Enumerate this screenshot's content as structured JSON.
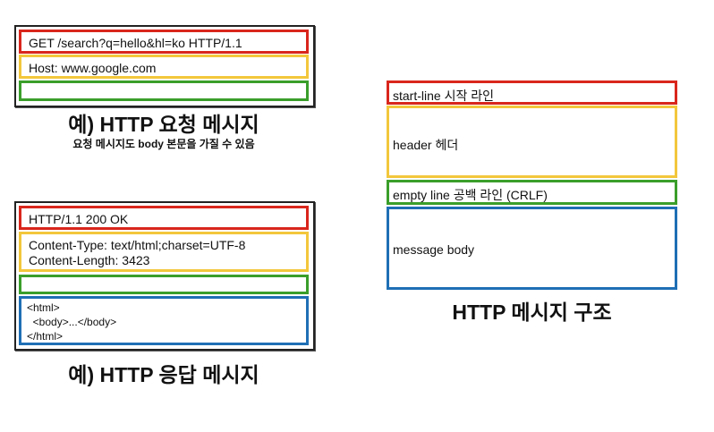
{
  "request_example": {
    "start_line": "GET /search?q=hello&hl=ko HTTP/1.1",
    "header": "Host: www.google.com",
    "caption": "예) HTTP 요청 메시지",
    "subcaption": "요청 메시지도 body 본문을 가질 수 있음"
  },
  "response_example": {
    "start_line": "HTTP/1.1 200 OK",
    "header_lines": [
      "Content-Type: text/html;charset=UTF-8",
      "Content-Length: 3423"
    ],
    "body_lines": [
      "<html>",
      "  <body>...</body>",
      "</html>"
    ],
    "caption": "예) HTTP 응답 메시지"
  },
  "structure": {
    "start_line": "start-line 시작 라인",
    "header": "header 헤더",
    "empty_line": "empty line 공백 라인 (CRLF)",
    "body": "message body",
    "caption": "HTTP 메시지 구조"
  },
  "colors": {
    "start_line": "#d9261c",
    "header": "#f3c73c",
    "empty_line": "#3a9e2a",
    "body": "#1f6fb5"
  }
}
